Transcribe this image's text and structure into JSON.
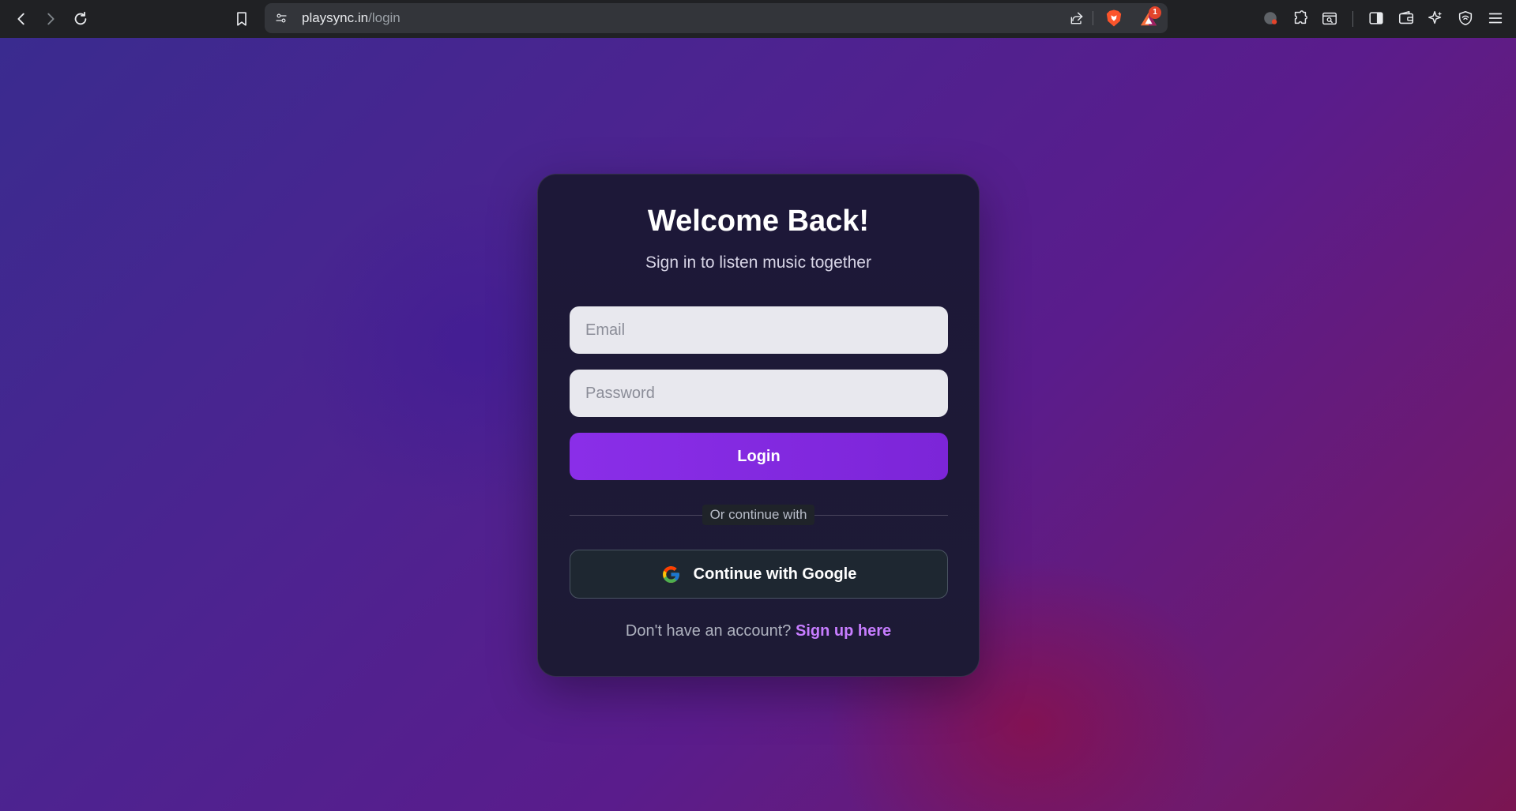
{
  "browser": {
    "url_domain": "playsync.in",
    "url_path": "/login",
    "rewards_badge_count": "1"
  },
  "login_card": {
    "title": "Welcome Back!",
    "subtitle": "Sign in to listen music together",
    "email_placeholder": "Email",
    "password_placeholder": "Password",
    "login_button_label": "Login",
    "divider_text": "Or continue with",
    "google_button_label": "Continue with Google",
    "signup_prompt": "Don't have an account?",
    "signup_link_label": "Sign up here"
  },
  "colors": {
    "accent": "#8a2ee8",
    "link": "#c77dff",
    "card_bg": "#1d1838"
  }
}
